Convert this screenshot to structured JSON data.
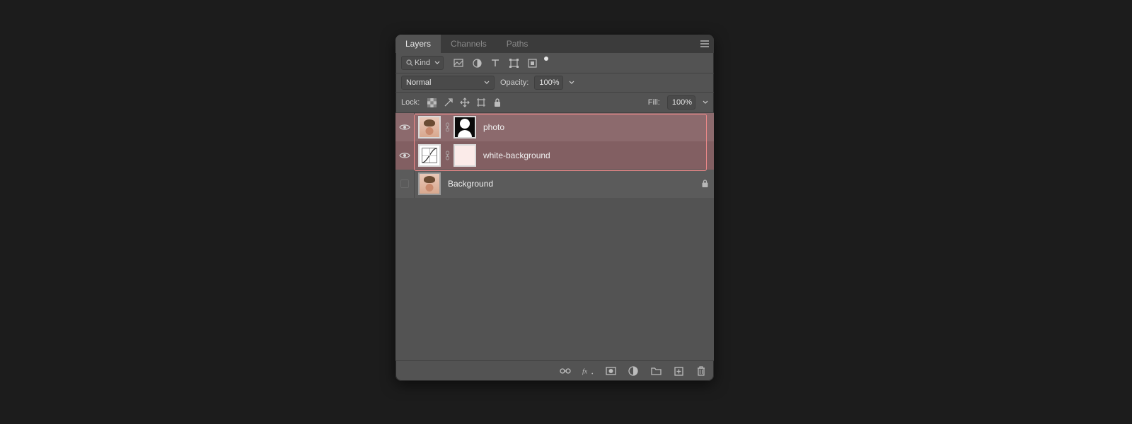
{
  "tabs": {
    "layers": "Layers",
    "channels": "Channels",
    "paths": "Paths"
  },
  "filter": {
    "kind": "Kind"
  },
  "blend": {
    "mode": "Normal",
    "opacity_label": "Opacity:",
    "opacity_value": "100%"
  },
  "lock": {
    "label": "Lock:",
    "fill_label": "Fill:",
    "fill_value": "100%"
  },
  "layers": {
    "items": [
      {
        "name": "photo",
        "visible": true,
        "selected": true,
        "has_mask": true,
        "locked": false
      },
      {
        "name": "white-background",
        "visible": true,
        "selected": true,
        "has_mask": true,
        "locked": false
      },
      {
        "name": "Background",
        "visible": false,
        "selected": false,
        "has_mask": false,
        "locked": true
      }
    ]
  }
}
